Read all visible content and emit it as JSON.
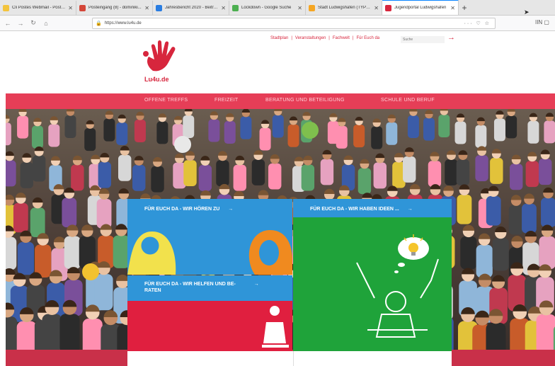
{
  "browser": {
    "tabs": [
      {
        "label": "Cli Postes Webmail - Posteingang",
        "favicon_color": "#f3c43d",
        "active": false
      },
      {
        "label": "Posteingang (8) - dominiki...",
        "favicon_color": "#d44638",
        "active": false
      },
      {
        "label": "Jahresbericht 2020 - Beitrag",
        "favicon_color": "#2a7de1",
        "active": false
      },
      {
        "label": "Lockdown - Google Suche",
        "favicon_color": "#4caf50",
        "active": false
      },
      {
        "label": "Stadt Ludwigshafen (TYPO3)",
        "favicon_color": "#f5a623",
        "active": false
      },
      {
        "label": "Jugendportal Ludwigshafen",
        "favicon_color": "#d7263d",
        "active": true
      }
    ],
    "new_tab": "+",
    "url": "https://www.lu4u.de",
    "url_right_icons": "··· ♡ ☆",
    "right_icons": "IIN ▢"
  },
  "header": {
    "logo_text": "Lu4u.de",
    "links": [
      "Stadtplan",
      "Veranstaltungen",
      "Fachwelt",
      "Für Euch da"
    ],
    "link_separator": "|",
    "search_placeholder": "Suche",
    "search_arrow": "→"
  },
  "nav": {
    "items": [
      "OFFENE TREFFS",
      "FREIZEIT",
      "BERATUNG UND BETEILIGUNG",
      "SCHULE UND BERUF"
    ]
  },
  "tiles": {
    "hoeren": "FÜR EUCH DA - WIR HÖREN ZU",
    "ideen": "FÜR EUCH DA - WIR HABEN IDEEN ...",
    "helfen_line1": "FÜR EUCH DA - WIR HELFEN UND BE-",
    "helfen_line2": "RATEN",
    "arrow": "→"
  },
  "colors": {
    "brand_red": "#e63e57",
    "tile_blue": "#2f95d8",
    "tile_green": "#1fa33a",
    "tile_red": "#e01f3f"
  }
}
